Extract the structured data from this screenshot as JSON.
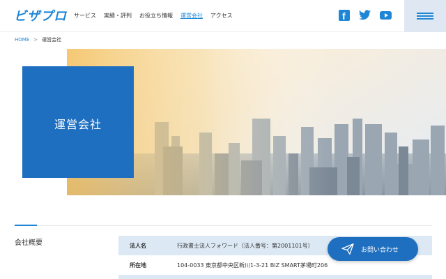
{
  "header": {
    "logo": "ビザプロ",
    "nav": [
      "サービス",
      "実績・評判",
      "お役立ち情報",
      "運営会社",
      "アクセス"
    ],
    "active_nav": "運営会社",
    "social_icons": [
      "facebook-icon",
      "twitter-icon",
      "youtube-icon"
    ],
    "menu_icon": "hamburger-icon"
  },
  "breadcrumb": {
    "home": "HOME",
    "separator": ">",
    "current": "運営会社"
  },
  "hero": {
    "title": "運営会社",
    "image": "city-skyline-photo"
  },
  "section": {
    "title": "会社概要",
    "rows": [
      {
        "label": "法人名",
        "value": "行政書士法人フォワード（法人番号：第2001101号）"
      },
      {
        "label": "所在地",
        "value": "104-0033 東京都中央区新川1-3-21 BIZ SMART茅場町206"
      }
    ]
  },
  "contact": {
    "label": "お問い合わせ",
    "icon": "paper-plane-icon"
  },
  "colors": {
    "brand": "#1f86d6",
    "hero_box": "#1f6fc1",
    "table_stripe": "#dce9f5",
    "menu_bg": "#dfe8f2"
  }
}
